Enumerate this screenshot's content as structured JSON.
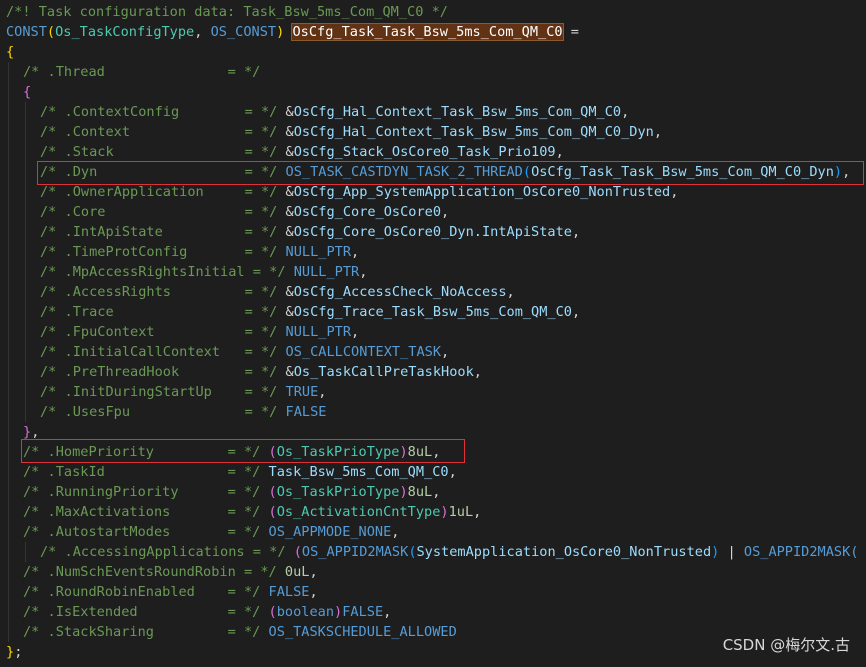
{
  "editor": {
    "lines": [
      {
        "tokens": [
          {
            "k": "c",
            "s": "/*! Task configuration data: Task_Bsw_5ms_Com_QM_C0 */"
          }
        ]
      },
      {
        "tokens": [
          {
            "k": "m",
            "s": "CONST"
          },
          {
            "k": "b1",
            "s": "("
          },
          {
            "k": "t",
            "s": "Os_TaskConfigType"
          },
          {
            "k": "p",
            "s": ", "
          },
          {
            "k": "m",
            "s": "OS_CONST"
          },
          {
            "k": "b1",
            "s": ")"
          },
          {
            "k": "p",
            "s": " "
          },
          {
            "k": "hl",
            "s": "OsCfg_Task_Task_Bsw_5ms_Com_QM_C0"
          },
          {
            "k": "p",
            "s": " ="
          }
        ]
      },
      {
        "tokens": [
          {
            "k": "b1",
            "s": "{"
          }
        ]
      },
      {
        "indent": 1,
        "tokens": [
          {
            "k": "c",
            "s": "/* .Thread               = */"
          }
        ]
      },
      {
        "indent": 1,
        "tokens": [
          {
            "k": "b2",
            "s": "{"
          }
        ]
      },
      {
        "indent": 2,
        "tokens": [
          {
            "k": "c",
            "s": "/* .ContextConfig        = */ "
          },
          {
            "k": "p",
            "s": "&"
          },
          {
            "k": "v",
            "s": "OsCfg_Hal_Context_Task_Bsw_5ms_Com_QM_C0"
          },
          {
            "k": "p",
            "s": ","
          }
        ]
      },
      {
        "indent": 2,
        "tokens": [
          {
            "k": "c",
            "s": "/* .Context              = */ "
          },
          {
            "k": "p",
            "s": "&"
          },
          {
            "k": "v",
            "s": "OsCfg_Hal_Context_Task_Bsw_5ms_Com_QM_C0_Dyn"
          },
          {
            "k": "p",
            "s": ","
          }
        ]
      },
      {
        "indent": 2,
        "tokens": [
          {
            "k": "c",
            "s": "/* .Stack                = */ "
          },
          {
            "k": "p",
            "s": "&"
          },
          {
            "k": "v",
            "s": "OsCfg_Stack_OsCore0_Task_Prio109"
          },
          {
            "k": "p",
            "s": ","
          }
        ]
      },
      {
        "indent": 2,
        "tokens": [
          {
            "k": "c",
            "s": "/* .Dyn                  = */ "
          },
          {
            "k": "m",
            "s": "OS_TASK_CASTDYN_TASK_2_THREAD"
          },
          {
            "k": "b3",
            "s": "("
          },
          {
            "k": "v",
            "s": "OsCfg_Task_Task_Bsw_5ms_Com_QM_C0_Dyn"
          },
          {
            "k": "b3",
            "s": ")"
          },
          {
            "k": "p",
            "s": ","
          }
        ]
      },
      {
        "indent": 2,
        "tokens": [
          {
            "k": "c",
            "s": "/* .OwnerApplication     = */ "
          },
          {
            "k": "p",
            "s": "&"
          },
          {
            "k": "v",
            "s": "OsCfg_App_SystemApplication_OsCore0_NonTrusted"
          },
          {
            "k": "p",
            "s": ","
          }
        ]
      },
      {
        "indent": 2,
        "tokens": [
          {
            "k": "c",
            "s": "/* .Core                 = */ "
          },
          {
            "k": "p",
            "s": "&"
          },
          {
            "k": "v",
            "s": "OsCfg_Core_OsCore0"
          },
          {
            "k": "p",
            "s": ","
          }
        ]
      },
      {
        "indent": 2,
        "tokens": [
          {
            "k": "c",
            "s": "/* .IntApiState          = */ "
          },
          {
            "k": "p",
            "s": "&"
          },
          {
            "k": "v",
            "s": "OsCfg_Core_OsCore0_Dyn.IntApiState"
          },
          {
            "k": "p",
            "s": ","
          }
        ]
      },
      {
        "indent": 2,
        "tokens": [
          {
            "k": "c",
            "s": "/* .TimeProtConfig       = */ "
          },
          {
            "k": "m",
            "s": "NULL_PTR"
          },
          {
            "k": "p",
            "s": ","
          }
        ]
      },
      {
        "indent": 2,
        "tokens": [
          {
            "k": "c",
            "s": "/* .MpAccessRightsInitial = */ "
          },
          {
            "k": "m",
            "s": "NULL_PTR"
          },
          {
            "k": "p",
            "s": ","
          }
        ]
      },
      {
        "indent": 2,
        "tokens": [
          {
            "k": "c",
            "s": "/* .AccessRights         = */ "
          },
          {
            "k": "p",
            "s": "&"
          },
          {
            "k": "v",
            "s": "OsCfg_AccessCheck_NoAccess"
          },
          {
            "k": "p",
            "s": ","
          }
        ]
      },
      {
        "indent": 2,
        "tokens": [
          {
            "k": "c",
            "s": "/* .Trace                = */ "
          },
          {
            "k": "p",
            "s": "&"
          },
          {
            "k": "v",
            "s": "OsCfg_Trace_Task_Bsw_5ms_Com_QM_C0"
          },
          {
            "k": "p",
            "s": ","
          }
        ]
      },
      {
        "indent": 2,
        "tokens": [
          {
            "k": "c",
            "s": "/* .FpuContext           = */ "
          },
          {
            "k": "m",
            "s": "NULL_PTR"
          },
          {
            "k": "p",
            "s": ","
          }
        ]
      },
      {
        "indent": 2,
        "tokens": [
          {
            "k": "c",
            "s": "/* .InitialCallContext   = */ "
          },
          {
            "k": "m",
            "s": "OS_CALLCONTEXT_TASK"
          },
          {
            "k": "p",
            "s": ","
          }
        ]
      },
      {
        "indent": 2,
        "tokens": [
          {
            "k": "c",
            "s": "/* .PreThreadHook        = */ "
          },
          {
            "k": "p",
            "s": "&"
          },
          {
            "k": "v",
            "s": "Os_TaskCallPreTaskHook"
          },
          {
            "k": "p",
            "s": ","
          }
        ]
      },
      {
        "indent": 2,
        "tokens": [
          {
            "k": "c",
            "s": "/* .InitDuringStartUp    = */ "
          },
          {
            "k": "m",
            "s": "TRUE"
          },
          {
            "k": "p",
            "s": ","
          }
        ]
      },
      {
        "indent": 2,
        "tokens": [
          {
            "k": "c",
            "s": "/* .UsesFpu              = */ "
          },
          {
            "k": "m",
            "s": "FALSE"
          }
        ]
      },
      {
        "indent": 1,
        "tokens": [
          {
            "k": "b2",
            "s": "}"
          },
          {
            "k": "p",
            "s": ","
          }
        ]
      },
      {
        "indent": 1,
        "tokens": [
          {
            "k": "c",
            "s": "/* .HomePriority         = */ "
          },
          {
            "k": "b2",
            "s": "("
          },
          {
            "k": "t",
            "s": "Os_TaskPrioType"
          },
          {
            "k": "b2",
            "s": ")"
          },
          {
            "k": "n",
            "s": "8uL"
          },
          {
            "k": "p",
            "s": ","
          }
        ]
      },
      {
        "indent": 1,
        "tokens": [
          {
            "k": "c",
            "s": "/* .TaskId               = */ "
          },
          {
            "k": "v",
            "s": "Task_Bsw_5ms_Com_QM_C0"
          },
          {
            "k": "p",
            "s": ","
          }
        ]
      },
      {
        "indent": 1,
        "tokens": [
          {
            "k": "c",
            "s": "/* .RunningPriority      = */ "
          },
          {
            "k": "b2",
            "s": "("
          },
          {
            "k": "t",
            "s": "Os_TaskPrioType"
          },
          {
            "k": "b2",
            "s": ")"
          },
          {
            "k": "n",
            "s": "8uL"
          },
          {
            "k": "p",
            "s": ","
          }
        ]
      },
      {
        "indent": 1,
        "tokens": [
          {
            "k": "c",
            "s": "/* .MaxActivations       = */ "
          },
          {
            "k": "b2",
            "s": "("
          },
          {
            "k": "t",
            "s": "Os_ActivationCntType"
          },
          {
            "k": "b2",
            "s": ")"
          },
          {
            "k": "n",
            "s": "1uL"
          },
          {
            "k": "p",
            "s": ","
          }
        ]
      },
      {
        "indent": 1,
        "tokens": [
          {
            "k": "c",
            "s": "/* .AutostartModes       = */ "
          },
          {
            "k": "m",
            "s": "OS_APPMODE_NONE"
          },
          {
            "k": "p",
            "s": ","
          }
        ]
      },
      {
        "indent": 2,
        "tokens": [
          {
            "k": "c",
            "s": "/* .AccessingApplications = */ "
          },
          {
            "k": "b2",
            "s": "("
          },
          {
            "k": "m",
            "s": "OS_APPID2MASK"
          },
          {
            "k": "b3",
            "s": "("
          },
          {
            "k": "v",
            "s": "SystemApplication_OsCore0_NonTrusted"
          },
          {
            "k": "b3",
            "s": ")"
          },
          {
            "k": "p",
            "s": " | "
          },
          {
            "k": "m",
            "s": "OS_APPID2MASK("
          }
        ]
      },
      {
        "indent": 1,
        "tokens": [
          {
            "k": "c",
            "s": "/* .NumSchEventsRoundRobin = */ "
          },
          {
            "k": "n",
            "s": "0uL"
          },
          {
            "k": "p",
            "s": ","
          }
        ]
      },
      {
        "indent": 1,
        "tokens": [
          {
            "k": "c",
            "s": "/* .RoundRobinEnabled    = */ "
          },
          {
            "k": "m",
            "s": "FALSE"
          },
          {
            "k": "p",
            "s": ","
          }
        ]
      },
      {
        "indent": 1,
        "tokens": [
          {
            "k": "c",
            "s": "/* .IsExtended           = */ "
          },
          {
            "k": "b2",
            "s": "("
          },
          {
            "k": "m",
            "s": "boolean"
          },
          {
            "k": "b2",
            "s": ")"
          },
          {
            "k": "m",
            "s": "FALSE"
          },
          {
            "k": "p",
            "s": ","
          }
        ]
      },
      {
        "indent": 1,
        "tokens": [
          {
            "k": "c",
            "s": "/* .StackSharing         = */ "
          },
          {
            "k": "m",
            "s": "OS_TASKSCHEDULE_ALLOWED"
          }
        ]
      },
      {
        "tokens": [
          {
            "k": "b1",
            "s": "}"
          },
          {
            "k": "p",
            "s": ";"
          }
        ]
      }
    ]
  },
  "watermark": "CSDN @梅尔文.古"
}
